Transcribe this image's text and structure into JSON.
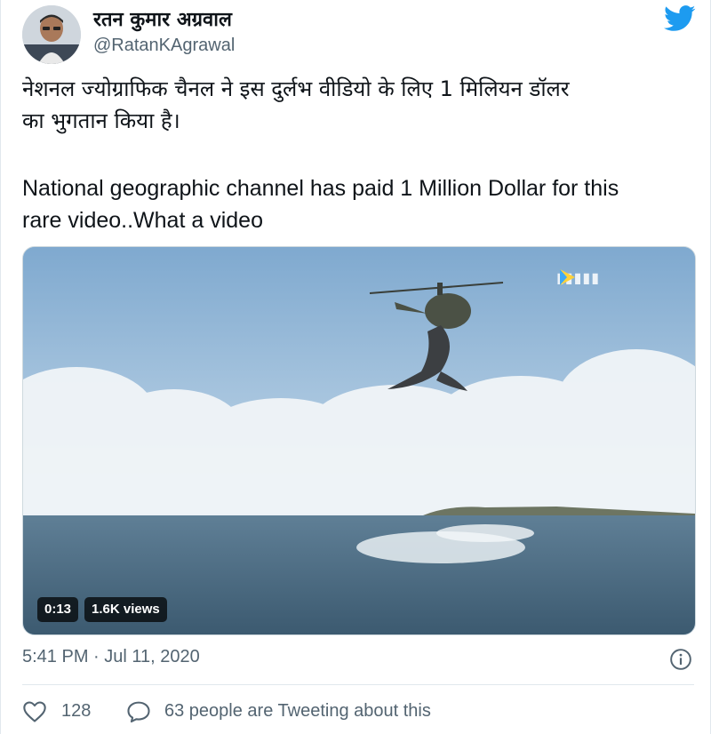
{
  "author": {
    "name": "रतन कुमार अग्रवाल",
    "handle": "@RatanKAgrawal"
  },
  "tweet": {
    "text_hindi_line1": "नेशनल ज्योग्राफिक चैनल ने इस दुर्लभ वीडियो के लिए 1 मिलियन डॉलर",
    "text_hindi_line2": "का भुगतान किया है।",
    "text_english_line1": "National geographic channel has paid 1 Million Dollar for this",
    "text_english_line2": "rare  video..What a video"
  },
  "media": {
    "duration": "0:13",
    "views": "1.6K views"
  },
  "footer": {
    "timestamp": "5:41 PM · Jul 11, 2020",
    "like_count": "128",
    "conversation": "63 people are Tweeting about this"
  },
  "colors": {
    "twitter_blue": "#1d9bf0",
    "secondary_text": "#536471",
    "like_grey": "#536471"
  },
  "icons": [
    "avatar",
    "twitter-logo-icon",
    "info-icon",
    "heart-icon",
    "reply-bubble-icon"
  ]
}
